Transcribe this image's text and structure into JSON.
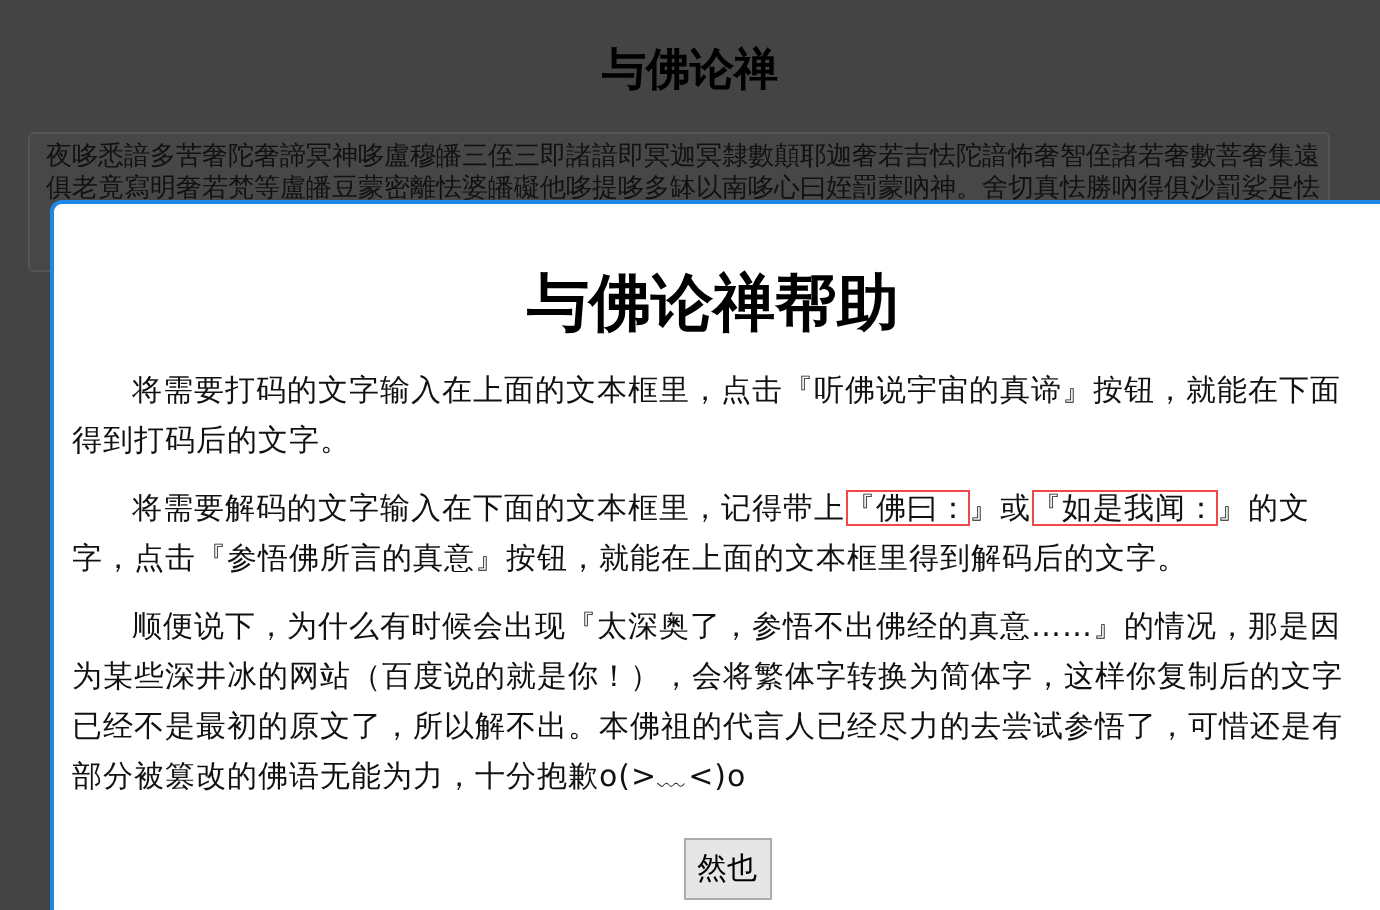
{
  "page": {
    "title": "与佛论禅",
    "textarea_lines": [
      "夜哆悉諳多苦奢陀奢諦冥神哆盧穆皤三侄三即諸諳即冥迦冥隸數顛耶迦奢若吉怯陀諳怖奢智侄諸若奢數菩奢集遠",
      "俱老竟寫明奢若梵等盧皤豆蒙密離怯婆皤礙他哆提哆多缽以南哆心曰姪罰蒙吶神。舍切真怯勝吶得俱沙罰娑是怯"
    ]
  },
  "dialog": {
    "title": "与佛论禅帮助",
    "paragraphs": [
      [
        {
          "text": "将需要打码的文字输入在上面的文本框里，点击『听佛说宇宙的真谛』按钮，就能在下面得到打码后的文字。",
          "boxed": false
        }
      ],
      [
        {
          "text": "将需要解码的文字输入在下面的文本框里，记得带上",
          "boxed": false
        },
        {
          "text": "『佛曰：",
          "boxed": true
        },
        {
          "text": "』或",
          "boxed": false
        },
        {
          "text": "『如是我闻：",
          "boxed": true
        },
        {
          "text": "』的文字，点击『参悟佛所言的真意』按钮，就能在上面的文本框里得到解码后的文字。",
          "boxed": false
        }
      ],
      [
        {
          "text": "顺便说下，为什么有时候会出现『太深奥了，参悟不出佛经的真意……』的情况，那是因为某些深井冰的网站（百度说的就是你！），会将繁体字转换为简体字，这样你复制后的文字已经不是最初的原文了，所以解不出。本佛祖的代言人已经尽力的去尝试参悟了，可惜还是有部分被篡改的佛语无能为力，十分抱歉o(>﹏<)o",
          "boxed": false
        }
      ]
    ],
    "button": "然也"
  }
}
